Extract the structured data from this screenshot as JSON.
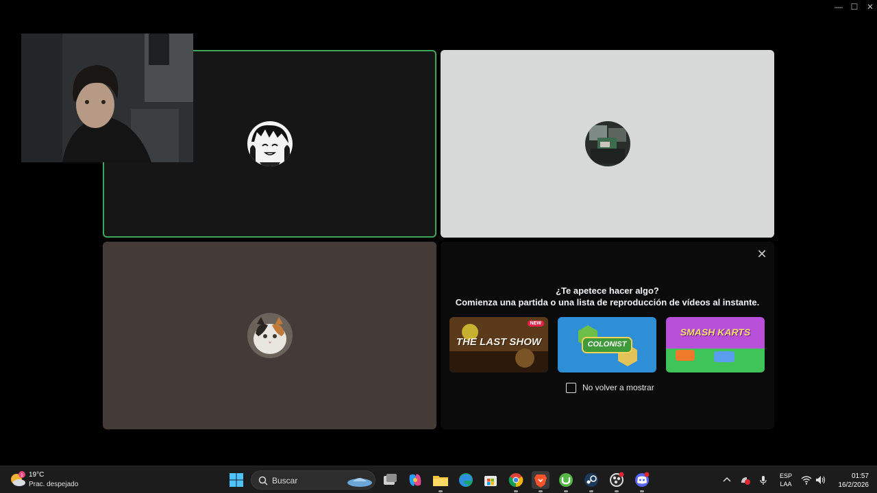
{
  "window": {
    "minimize_glyph": "—",
    "maximize_glyph": "☐",
    "close_glyph": "✕"
  },
  "activity_panel": {
    "title": "¿Te apetece hacer algo?",
    "subtitle": "Comienza una partida o una lista de reproducción de vídeos al instante.",
    "close_glyph": "✕",
    "games": [
      {
        "name": "THE LAST SHOW",
        "badge": "NEW"
      },
      {
        "name": "COLONIST"
      },
      {
        "name": "SMASH KARTS"
      }
    ],
    "dont_show_label": "No volver a mostrar"
  },
  "taskbar": {
    "weather": {
      "temp": "19°C",
      "desc": "Prac. despejado",
      "badge": "1"
    },
    "search_placeholder": "Buscar",
    "lang_line1": "ESP",
    "lang_line2": "LAA",
    "time": "01:57",
    "date": "16/2/2026"
  },
  "colors": {
    "speaking_border": "#3fa65c",
    "taskbar_bg": "#1c1c1c",
    "panel_bg": "#0b0b0c"
  }
}
